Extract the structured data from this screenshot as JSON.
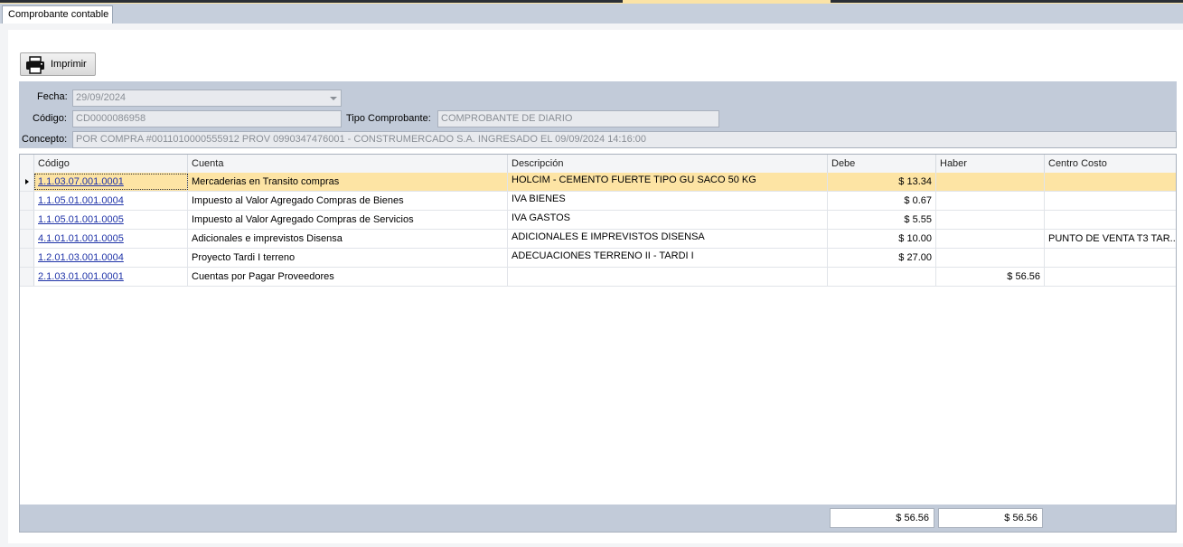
{
  "tab": {
    "label": "Comprobante contable"
  },
  "toolbar": {
    "print_label": "Imprimir",
    "print_icon": "printer-icon"
  },
  "header": {
    "fecha_label": "Fecha:",
    "fecha_value": "29/09/2024",
    "codigo_label": "Código:",
    "codigo_value": "CD0000086958",
    "tipo_label": "Tipo Comprobante:",
    "tipo_value": "COMPROBANTE DE DIARIO",
    "concepto_label": "Concepto:",
    "concepto_value": "POR COMPRA  #0011010000555912 PROV 0990347476001 - CONSTRUMERCADO S.A. INGRESADO EL 09/09/2024 14:16:00"
  },
  "grid": {
    "columns": [
      "Código",
      "Cuenta",
      "Descripción",
      "Debe",
      "Haber",
      "Centro Costo"
    ],
    "rows": [
      {
        "codigo": "1.1.03.07.001.0001",
        "cuenta": "Mercaderias en Transito compras",
        "descripcion": "HOLCIM  - CEMENTO FUERTE TIPO GU SACO 50 KG",
        "debe": "$ 13.34",
        "haber": "",
        "centro": ""
      },
      {
        "codigo": "1.1.05.01.001.0004",
        "cuenta": "Impuesto al Valor Agregado Compras de Bienes",
        "descripcion": "IVA BIENES",
        "debe": "$ 0.67",
        "haber": "",
        "centro": ""
      },
      {
        "codigo": "1.1.05.01.001.0005",
        "cuenta": "Impuesto al Valor Agregado Compras de Servicios",
        "descripcion": "IVA GASTOS",
        "debe": "$ 5.55",
        "haber": "",
        "centro": ""
      },
      {
        "codigo": "4.1.01.01.001.0005",
        "cuenta": "Adicionales e imprevistos Disensa",
        "descripcion": "ADICIONALES E IMPREVISTOS DISENSA",
        "debe": "$ 10.00",
        "haber": "",
        "centro": "PUNTO DE VENTA T3 TAR..."
      },
      {
        "codigo": "1.2.01.03.001.0004",
        "cuenta": "Proyecto Tardi I terreno",
        "descripcion": "ADECUACIONES TERRENO II - TARDI I",
        "debe": "$ 27.00",
        "haber": "",
        "centro": ""
      },
      {
        "codigo": "2.1.03.01.001.0001",
        "cuenta": "Cuentas por Pagar Proveedores",
        "descripcion": "",
        "debe": "",
        "haber": "$ 56.56",
        "centro": ""
      }
    ],
    "selected_row": 0,
    "totals": {
      "debe": "$ 56.56",
      "haber": "$ 56.56"
    }
  },
  "colors": {
    "selected_row": "#fde4a4",
    "header_panel": "#c2cbd9",
    "link": "#1f33a8"
  }
}
